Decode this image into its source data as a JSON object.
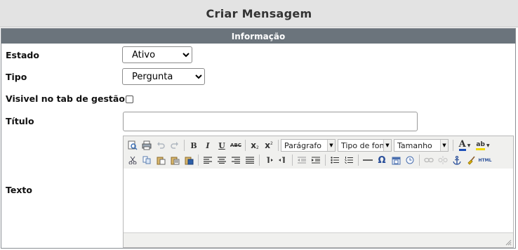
{
  "page": {
    "title": "Criar Mensagem"
  },
  "section": {
    "title": "Informação"
  },
  "fields": {
    "estado": {
      "label": "Estado",
      "value": "Ativo"
    },
    "tipo": {
      "label": "Tipo",
      "value": "Pergunta"
    },
    "visivel": {
      "label": "Visivel no tab de gestão",
      "checked": false
    },
    "titulo": {
      "label": "Título",
      "value": ""
    },
    "texto": {
      "label": "Texto"
    }
  },
  "editor": {
    "format_dropdown": "Parágrafo",
    "font_dropdown": "Tipo de font",
    "size_dropdown": "Tamanho",
    "row1_icons": [
      "preview-icon",
      "print-icon",
      "undo-icon",
      "redo-icon",
      "bold-icon",
      "italic-icon",
      "underline-icon",
      "strikethrough-icon",
      "subscript-icon",
      "superscript-icon"
    ],
    "row1_tail_icons": [
      "font-color-icon",
      "highlight-color-icon"
    ],
    "row2_icons": [
      "cut-icon",
      "copy-icon",
      "paste-icon",
      "paste-text-icon",
      "paste-word-icon",
      "align-left-icon",
      "align-center-icon",
      "align-right-icon",
      "align-justify-icon",
      "ltr-icon",
      "rtl-icon",
      "outdent-icon",
      "indent-icon",
      "bullet-list-icon",
      "numbered-list-icon",
      "horizontal-rule-icon",
      "special-char-icon",
      "insert-date-icon",
      "insert-time-icon",
      "link-icon",
      "unlink-icon",
      "anchor-icon",
      "cleanup-icon",
      "html-icon"
    ],
    "labels": {
      "bold": "B",
      "italic": "I",
      "underline": "U",
      "strike": "ABC",
      "sub": "x",
      "sup": "x",
      "omega": "Ω",
      "html": "HTML",
      "font_color": "A",
      "highlight": "ab"
    }
  }
}
